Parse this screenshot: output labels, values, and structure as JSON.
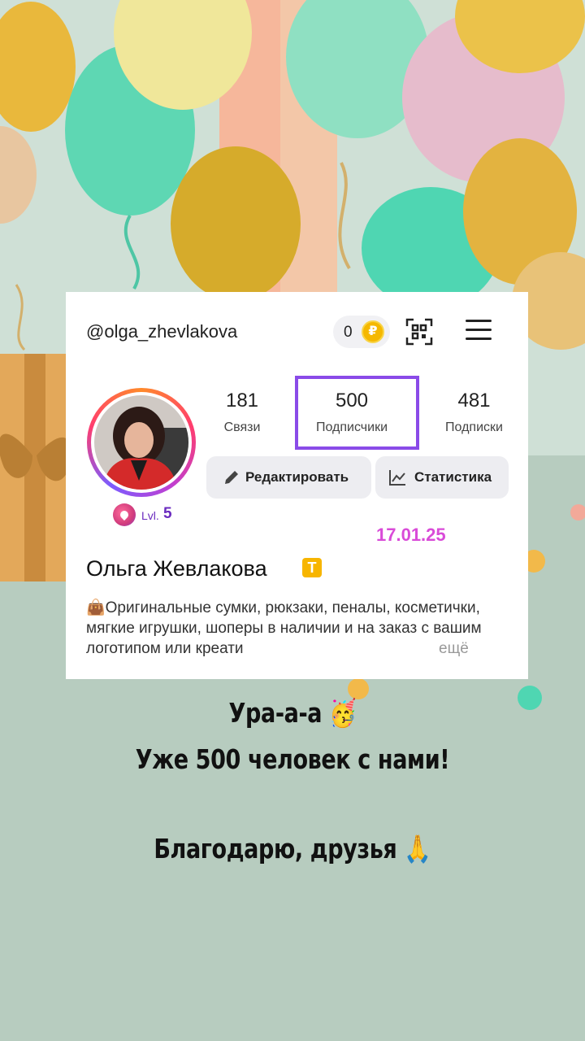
{
  "profile": {
    "username": "@olga_zhevlakova",
    "coins": "0",
    "coin_symbol": "₽",
    "level_label": "Lvl.",
    "level_value": "5",
    "stats": [
      {
        "value": "181",
        "label": "Связи"
      },
      {
        "value": "500",
        "label": "Подписчики"
      },
      {
        "value": "481",
        "label": "Подписки"
      }
    ],
    "edit_button": "Редактировать",
    "stats_button": "Статистика",
    "full_name": "Ольга Жевлакова",
    "verified_mark": "T",
    "bio": "👜Оригинальные сумки, рюкзаки, пеналы, косметички, мягкие игрушки, шоперы в наличии и на заказ с вашим логотипом или креати",
    "bio_more": "ещё"
  },
  "date_stamp": "17.01.25",
  "caption": {
    "line1": "Ура-а-а 🥳",
    "line2": "Уже 500 человек с нами!",
    "line3": "Благодарю, друзья 🙏"
  },
  "colors": {
    "highlight": "#8a4be8",
    "date": "#d94bd8",
    "coin": "#f5b800",
    "level": "#6a2bbf"
  },
  "icons": [
    "coin-icon",
    "qr-code-icon",
    "hamburger-menu-icon",
    "pencil-icon",
    "chart-icon",
    "level-badge-icon",
    "verified-icon"
  ]
}
